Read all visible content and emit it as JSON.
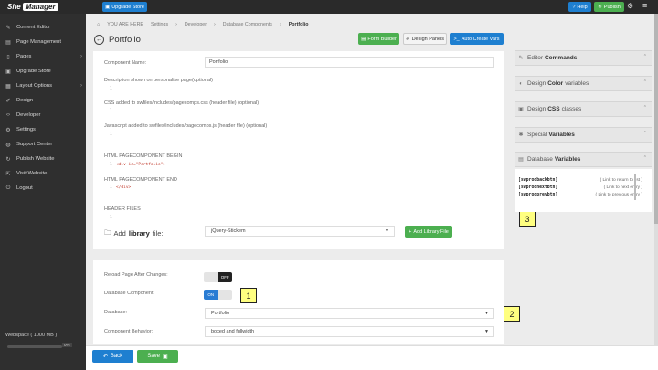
{
  "topbar": {
    "logo_part1": "Site",
    "logo_part2": "Manager",
    "upgrade_label": "Upgrade Store",
    "help_label": "Help",
    "publish_label": "Publish"
  },
  "sidebar": {
    "items": [
      {
        "label": "Content Editor",
        "icon": "pencil-icon",
        "glyph": "✎"
      },
      {
        "label": "Page Management",
        "icon": "file-icon",
        "glyph": "▤"
      },
      {
        "label": "Pages",
        "icon": "document-icon",
        "glyph": "▯"
      },
      {
        "label": "Upgrade Store",
        "icon": "store-icon",
        "glyph": "▣"
      },
      {
        "label": "Layout Options",
        "icon": "layout-icon",
        "glyph": "▦"
      },
      {
        "label": "Design",
        "icon": "brush-icon",
        "glyph": "✐"
      },
      {
        "label": "Developer",
        "icon": "code-icon",
        "glyph": "‹›"
      },
      {
        "label": "Settings",
        "icon": "gear-icon",
        "glyph": "⚙"
      },
      {
        "label": "Support Center",
        "icon": "support-icon",
        "glyph": "◍"
      },
      {
        "label": "Publish Website",
        "icon": "publish-icon",
        "glyph": "↻"
      },
      {
        "label": "Visit Website",
        "icon": "external-icon",
        "glyph": "⇱"
      },
      {
        "label": "Logout",
        "icon": "power-icon",
        "glyph": "⏻"
      }
    ],
    "workspace_label": "Webspace ( 1000 MB )",
    "workspace_percent": "0%"
  },
  "breadcrumb": {
    "home": "YOU ARE HERE",
    "items": [
      "Settings",
      "Developer",
      "Database Components"
    ],
    "current": "Portfolio"
  },
  "page": {
    "title": "Portfolio",
    "form_builder": "Form Builder",
    "design_panels": "Design Panels",
    "auto_create_vars": "Auto Create Vars"
  },
  "form": {
    "component_name_label": "Component Name:",
    "component_name_value": "Portfolio",
    "desc_label": "Description shown on personalise page(optional)",
    "css_label": "CSS added to swfiles/includes/pagecomps.css (header file) (optional)",
    "js_label": "Javascript added to swfiles/includes/pagecomps.js (header file) (optional)",
    "begin_label": "HTML PAGECOMPONENT BEGIN",
    "begin_code": "<div id=\"Portfolio\">",
    "end_label": "HTML PAGECOMPONENT END",
    "end_code": "</div>",
    "header_files_label": "HEADER FILES",
    "line_no": "1",
    "add_library_prefix": "Add",
    "add_library_bold": "library",
    "add_library_suffix": "file:",
    "library_value": "jQuery-Stickem",
    "add_library_button": "Add Library File"
  },
  "settings": {
    "reload_label": "Reload Page After Changes:",
    "reload_state": "OFF",
    "db_component_label": "Database Component:",
    "db_component_state": "ON",
    "database_label": "Database:",
    "database_value": "Portfolio",
    "behavior_label": "Component Behavior:",
    "behavior_value": "boxed and fullwidth"
  },
  "right_panel": {
    "sections": [
      {
        "prefix": "Editor",
        "bold": "Commands",
        "icon": "edit-icon",
        "glyph": "✎"
      },
      {
        "prefix": "Design",
        "bold": "Color",
        "suffix": "variables",
        "icon": "palette-icon",
        "glyph": "◐"
      },
      {
        "prefix": "Design",
        "bold": "CSS",
        "suffix": "classes",
        "icon": "css-icon",
        "glyph": "▣"
      },
      {
        "prefix": "Special",
        "bold": "Variables",
        "icon": "special-icon",
        "glyph": "✱"
      },
      {
        "prefix": "Database",
        "bold": "Variables",
        "icon": "database-icon",
        "glyph": "▤"
      }
    ],
    "db_vars": [
      {
        "key": "[swprodbackbtn]",
        "desc": "( Link to return to list )"
      },
      {
        "key": "[swprodnextbtn]",
        "desc": "( Link to next entry )"
      },
      {
        "key": "[swprodprevbtn]",
        "desc": "( Link to previous entry )"
      }
    ]
  },
  "badges": [
    "1",
    "2",
    "3"
  ],
  "bottom": {
    "back_label": "Back",
    "save_label": "Save"
  }
}
